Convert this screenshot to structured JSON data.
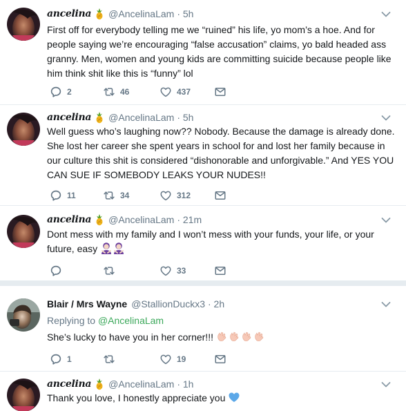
{
  "tweets": [
    {
      "display_name": "ancelina",
      "handle": "@AncelinaLam",
      "time": "· 5h",
      "text": "First off for everybody telling me we “ruined” his life, yo mom’s a hoe. And for people saying we’re encouraging “false accusation” claims, yo bald headed ass granny. Men, women and young kids are committing suicide because people like him think shit like this is “funny” lol",
      "replies": "2",
      "retweets": "46",
      "likes": "437"
    },
    {
      "display_name": "ancelina",
      "handle": "@AncelinaLam",
      "time": "· 5h",
      "text": "Well guess who’s laughing now?? Nobody. Because the damage is already done. She lost her career she spent years in school for and lost her family because in our culture this shit is considered “dishonorable and unforgivable.” And YES YOU CAN SUE IF SOMEBODY LEAKS YOUR NUDES!!",
      "replies": "11",
      "retweets": "34",
      "likes": "312"
    },
    {
      "display_name": "ancelina",
      "handle": "@AncelinaLam",
      "time": "· 21m",
      "text": "Dont mess with my family and I won’t mess with your funds, your life, or your future, easy",
      "replies": "",
      "retweets": "",
      "likes": "33"
    },
    {
      "display_name": "Blair / Mrs Wayne",
      "handle": "@StallionDuckx3",
      "time": "· 2h",
      "replying_label": "Replying to",
      "replying_handle": "@AncelinaLam",
      "text": "She’s lucky to have you in her corner!!!",
      "replies": "1",
      "retweets": "",
      "likes": "19"
    },
    {
      "display_name": "ancelina",
      "handle": "@AncelinaLam",
      "time": "· 1h",
      "text": "Thank you love, I honestly appreciate you"
    }
  ],
  "colors": {
    "muted": "#657786",
    "link_green": "#3ba85a",
    "divider": "#e6ecf0"
  },
  "icons": [
    "reply-icon",
    "retweet-icon",
    "like-icon",
    "direct-message-icon",
    "chevron-down-icon",
    "pineapple-emoji",
    "woman-gesturing-emoji",
    "clapping-emoji",
    "blue-heart-emoji"
  ]
}
